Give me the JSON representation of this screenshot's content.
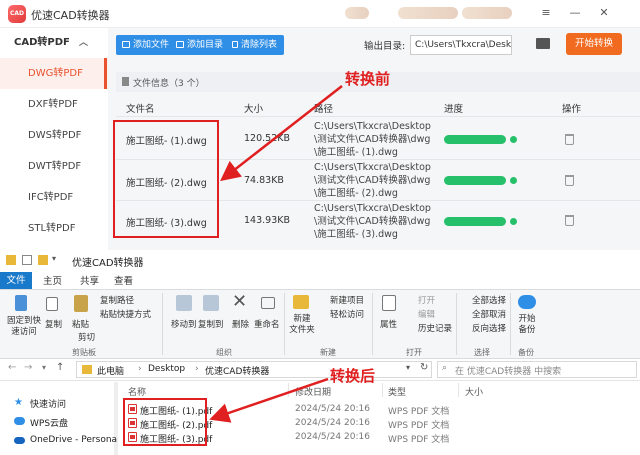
{
  "app": {
    "logo_text": "CAD",
    "title": "优速CAD转换器",
    "window_controls": [
      "≡",
      "—",
      "✕"
    ],
    "sidebar": {
      "header": "CAD转PDF",
      "items": [
        {
          "label": "DWG转PDF",
          "active": true
        },
        {
          "label": "DXF转PDF",
          "active": false
        },
        {
          "label": "DWS转PDF",
          "active": false
        },
        {
          "label": "DWT转PDF",
          "active": false
        },
        {
          "label": "IFC转PDF",
          "active": false
        },
        {
          "label": "STL转PDF",
          "active": false
        }
      ]
    },
    "toolbar": {
      "add_file": "添加文件",
      "add_folder": "添加目录",
      "clear_list": "清除列表",
      "output_label": "输出目录:",
      "output_path": "C:\\Users\\Tkxcra\\Desktop",
      "start_button": "开始转换"
    },
    "file_info": "文件信息（3 个）",
    "table": {
      "headers": [
        "文件名",
        "大小",
        "路径",
        "进度",
        "操作"
      ],
      "rows": [
        {
          "name": "施工图纸- (1).dwg",
          "size": "120.52KB",
          "path": [
            "C:\\Users\\Tkxcra\\Desktop",
            "\\测试文件\\CAD转换器\\dwg",
            "\\施工图纸- (1).dwg"
          ],
          "progress": 1.0
        },
        {
          "name": "施工图纸- (2).dwg",
          "size": "74.83KB",
          "path": [
            "C:\\Users\\Tkxcra\\Desktop",
            "\\测试文件\\CAD转换器\\dwg",
            "\\施工图纸- (2).dwg"
          ],
          "progress": 1.0
        },
        {
          "name": "施工图纸- (3).dwg",
          "size": "143.93KB",
          "path": [
            "C:\\Users\\Tkxcra\\Desktop",
            "\\测试文件\\CAD转换器\\dwg",
            "\\施工图纸- (3).dwg"
          ],
          "progress": 1.0
        }
      ]
    },
    "annotation_before": "转换前"
  },
  "explorer": {
    "title": "优速CAD转换器",
    "ribbon_tabs": [
      "文件",
      "主页",
      "共享",
      "查看"
    ],
    "ribbon": {
      "clipboard": {
        "pin": "固定到快\n速访问",
        "copy": "复制",
        "paste": "粘贴",
        "copy_path": "复制路径",
        "paste_shortcut": "粘贴快捷方式",
        "cut": "剪切",
        "group": "剪贴板"
      },
      "organize": {
        "move_to": "移动到",
        "copy_to": "复制到",
        "delete": "删除",
        "rename": "重命名",
        "group": "组织"
      },
      "new": {
        "new_folder": "新建\n文件夹",
        "new_item": "新建项目",
        "easy_access": "轻松访问",
        "group": "新建"
      },
      "open": {
        "properties": "属性",
        "open": "打开",
        "edit": "编辑",
        "history": "历史记录",
        "group": "打开"
      },
      "select": {
        "select_all": "全部选择",
        "select_none": "全部取消",
        "invert": "反向选择",
        "group": "选择"
      },
      "backup": {
        "start_backup": "开始\n备份",
        "group": "备份"
      }
    },
    "address": {
      "crumbs": [
        "此电脑",
        "Desktop",
        "优速CAD转换器"
      ],
      "search_placeholder": "在 优速CAD转换器 中搜索"
    },
    "nav": [
      "快速访问",
      "WPS云盘",
      "OneDrive - Persona"
    ],
    "columns": [
      "名称",
      "修改日期",
      "类型",
      "大小"
    ],
    "files": [
      {
        "name": "施工图纸- (1).pdf",
        "date": "2024/5/24 20:16",
        "type": "WPS PDF 文档"
      },
      {
        "name": "施工图纸- (2).pdf",
        "date": "2024/5/24 20:16",
        "type": "WPS PDF 文档"
      },
      {
        "name": "施工图纸- (3).pdf",
        "date": "2024/5/24 20:16",
        "type": "WPS PDF 文档"
      }
    ],
    "annotation_after": "转换后"
  },
  "colors": {
    "accent_orange": "#f06a1f",
    "toolbar_blue": "#2f8ee6",
    "progress_green": "#27c06a",
    "annotation_red": "#e02020",
    "file_tab_blue": "#1979ca"
  }
}
